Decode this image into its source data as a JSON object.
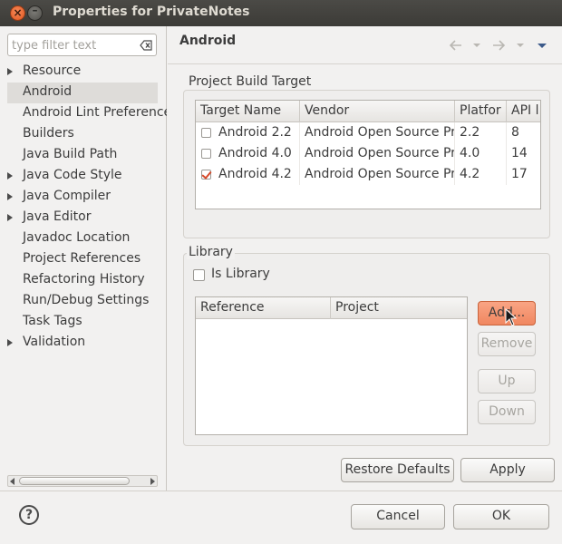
{
  "window": {
    "title": "Properties for PrivateNotes"
  },
  "filter": {
    "placeholder": "type filter text"
  },
  "tree": [
    {
      "label": "Resource",
      "expandable": true,
      "selected": false
    },
    {
      "label": "Android",
      "expandable": false,
      "selected": true
    },
    {
      "label": "Android Lint Preferences",
      "expandable": false,
      "selected": false
    },
    {
      "label": "Builders",
      "expandable": false,
      "selected": false
    },
    {
      "label": "Java Build Path",
      "expandable": false,
      "selected": false
    },
    {
      "label": "Java Code Style",
      "expandable": true,
      "selected": false
    },
    {
      "label": "Java Compiler",
      "expandable": true,
      "selected": false
    },
    {
      "label": "Java Editor",
      "expandable": true,
      "selected": false
    },
    {
      "label": "Javadoc Location",
      "expandable": false,
      "selected": false
    },
    {
      "label": "Project References",
      "expandable": false,
      "selected": false
    },
    {
      "label": "Refactoring History",
      "expandable": false,
      "selected": false
    },
    {
      "label": "Run/Debug Settings",
      "expandable": false,
      "selected": false
    },
    {
      "label": "Task Tags",
      "expandable": false,
      "selected": false
    },
    {
      "label": "Validation",
      "expandable": true,
      "selected": false
    }
  ],
  "page": {
    "title": "Android"
  },
  "build_target": {
    "legend": "Project Build Target",
    "columns": [
      "Target Name",
      "Vendor",
      "Platfor",
      "API l"
    ],
    "rows": [
      {
        "checked": false,
        "name": "Android 2.2",
        "vendor": "Android Open Source Project",
        "platform": "2.2",
        "api": "8"
      },
      {
        "checked": false,
        "name": "Android 4.0",
        "vendor": "Android Open Source Project",
        "platform": "4.0",
        "api": "14"
      },
      {
        "checked": true,
        "name": "Android 4.2",
        "vendor": "Android Open Source Project",
        "platform": "4.2",
        "api": "17"
      }
    ]
  },
  "library": {
    "legend": "Library",
    "is_library_label": "Is Library",
    "is_library_checked": false,
    "columns": [
      "Reference",
      "Project"
    ],
    "buttons": {
      "add": "Add...",
      "remove": "Remove",
      "up": "Up",
      "down": "Down"
    }
  },
  "actions": {
    "restore_defaults": "Restore Defaults",
    "apply": "Apply"
  },
  "footer": {
    "help": "?",
    "cancel": "Cancel",
    "ok": "OK"
  },
  "colors": {
    "titlebar": "#3c3b37",
    "accent": "#f08760",
    "close": "#e2561e",
    "check": "#d6492a"
  }
}
